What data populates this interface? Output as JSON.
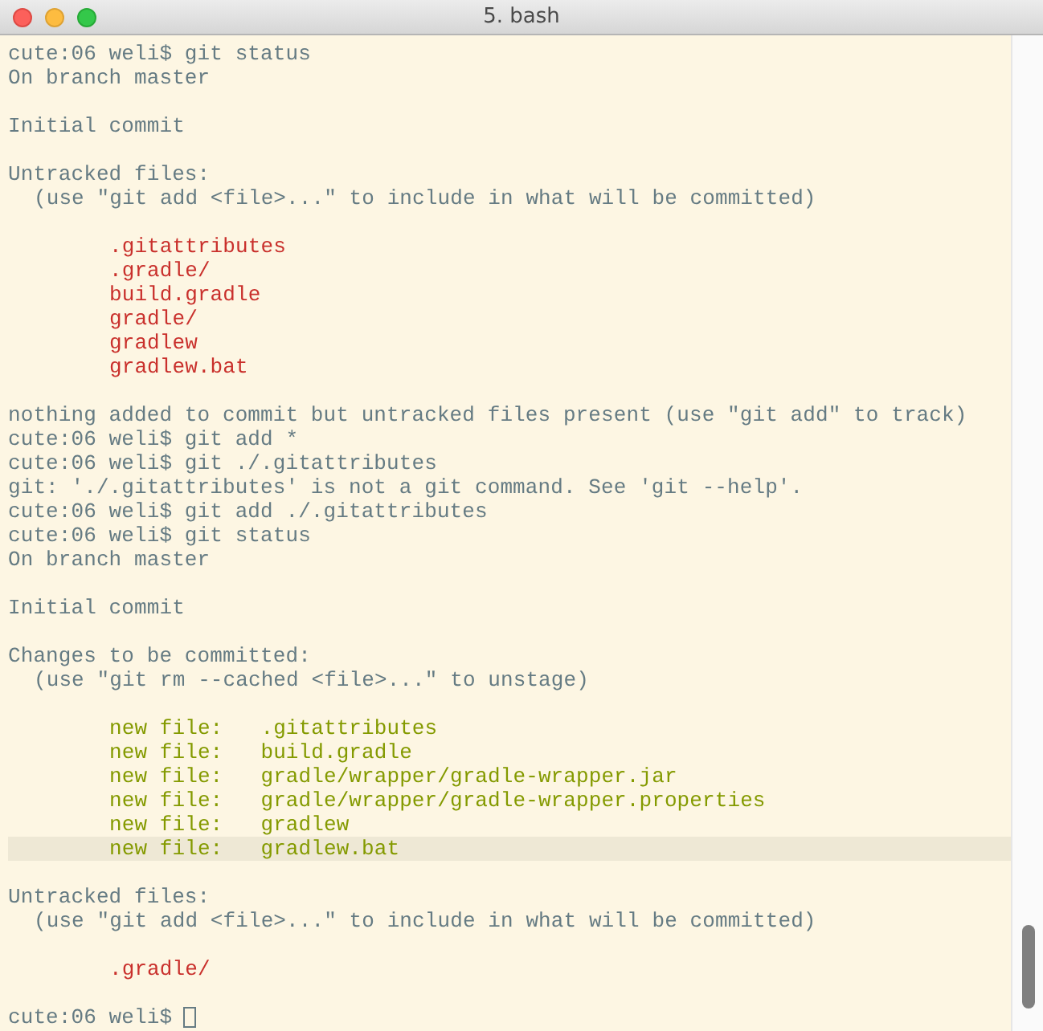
{
  "window": {
    "title": "5. bash"
  },
  "lines": [
    {
      "kind": "prompt",
      "text": "cute:06 weli$ git status",
      "cursor": false
    },
    {
      "kind": "output",
      "text": "On branch master"
    },
    {
      "kind": "blank"
    },
    {
      "kind": "output",
      "text": "Initial commit"
    },
    {
      "kind": "blank"
    },
    {
      "kind": "output",
      "text": "Untracked files:"
    },
    {
      "kind": "hint",
      "text": "(use \"git add <file>...\" to include in what will be committed)"
    },
    {
      "kind": "blank"
    },
    {
      "kind": "untracked",
      "text": ".gitattributes"
    },
    {
      "kind": "untracked",
      "text": ".gradle/"
    },
    {
      "kind": "untracked",
      "text": "build.gradle"
    },
    {
      "kind": "untracked",
      "text": "gradle/"
    },
    {
      "kind": "untracked",
      "text": "gradlew"
    },
    {
      "kind": "untracked",
      "text": "gradlew.bat"
    },
    {
      "kind": "blank"
    },
    {
      "kind": "output",
      "text": "nothing added to commit but untracked files present (use \"git add\" to track)"
    },
    {
      "kind": "prompt",
      "text": "cute:06 weli$ git add *",
      "cursor": false
    },
    {
      "kind": "prompt",
      "text": "cute:06 weli$ git ./.gitattributes",
      "cursor": false
    },
    {
      "kind": "output",
      "text": "git: './.gitattributes' is not a git command. See 'git --help'."
    },
    {
      "kind": "prompt",
      "text": "cute:06 weli$ git add ./.gitattributes",
      "cursor": false
    },
    {
      "kind": "prompt",
      "text": "cute:06 weli$ git status",
      "cursor": false
    },
    {
      "kind": "output",
      "text": "On branch master"
    },
    {
      "kind": "blank"
    },
    {
      "kind": "output",
      "text": "Initial commit"
    },
    {
      "kind": "blank"
    },
    {
      "kind": "output",
      "text": "Changes to be committed:"
    },
    {
      "kind": "hint",
      "text": "(use \"git rm --cached <file>...\" to unstage)"
    },
    {
      "kind": "blank"
    },
    {
      "kind": "staged",
      "files": [
        {
          "text": "new file:   .gitattributes",
          "selected": false
        },
        {
          "text": "new file:   build.gradle",
          "selected": false
        },
        {
          "text": "new file:   gradle/wrapper/gradle-wrapper.jar",
          "selected": false
        },
        {
          "text": "new file:   gradle/wrapper/gradle-wrapper.properties",
          "selected": false
        },
        {
          "text": "new file:   gradlew",
          "selected": false
        },
        {
          "text": "new file:   gradlew.bat",
          "selected": true
        }
      ]
    },
    {
      "kind": "blank"
    },
    {
      "kind": "output",
      "text": "Untracked files:"
    },
    {
      "kind": "hint",
      "text": "(use \"git add <file>...\" to include in what will be committed)"
    },
    {
      "kind": "blank"
    },
    {
      "kind": "untracked",
      "text": ".gradle/"
    },
    {
      "kind": "blank"
    },
    {
      "kind": "prompt",
      "text": "cute:06 weli$",
      "cursor": true
    }
  ]
}
